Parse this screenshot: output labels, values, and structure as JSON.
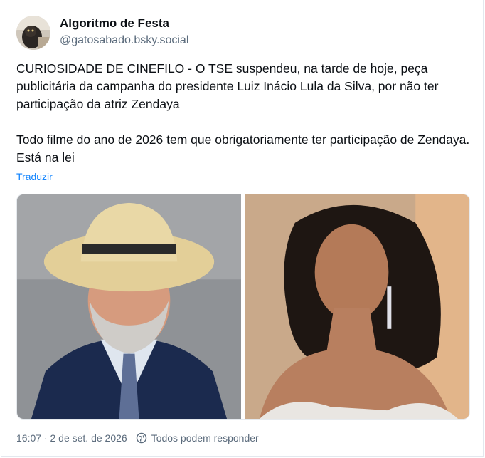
{
  "post": {
    "author_name": "Algoritmo de Festa",
    "author_handle": "@gatosabado.bsky.social",
    "text": "CURIOSIDADE DE CINEFILO - O TSE suspendeu, na tarde de hoje, peça publicitária da campanha do presidente Luiz Inácio Lula da Silva, por não ter participação da atriz Zendaya\n\nTodo filme do ano de 2026 tem que obrigatoriamente ter participação de Zendaya. Está na lei",
    "translate_label": "Traduzir",
    "timestamp": "16:07 · 2 de set. de 2026",
    "reply_setting": "Todos podem responder"
  },
  "colors": {
    "link": "#1083fe",
    "muted": "#5b6b7c",
    "border": "#e3e8ee"
  },
  "icons": {
    "reply_setting_icon": "globe-icon"
  }
}
